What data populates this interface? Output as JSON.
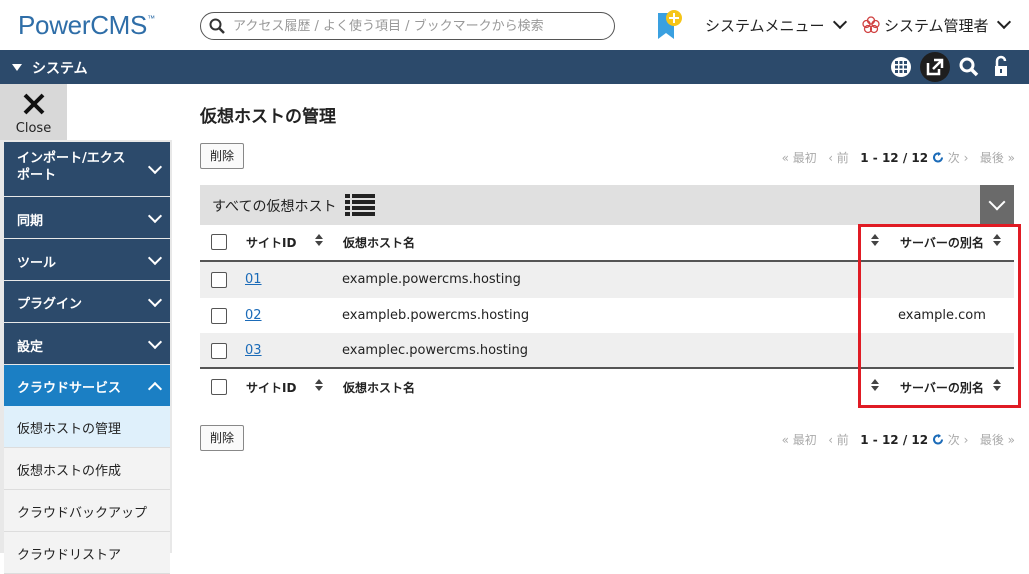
{
  "header": {
    "logo_text": "PowerCMS",
    "logo_tm": "™",
    "search_placeholder": "アクセス履歴 / よく使う項目 / ブックマークから検索",
    "system_menu_label": "システムメニュー",
    "user_menu_label": "システム管理者"
  },
  "system_bar": {
    "title": "システム"
  },
  "sidebar": {
    "close_label": "Close",
    "items": [
      {
        "label": "インポート/エクス\nポート"
      },
      {
        "label": "同期"
      },
      {
        "label": "ツール"
      },
      {
        "label": "プラグイン"
      },
      {
        "label": "設定"
      },
      {
        "label": "クラウドサービス"
      }
    ],
    "sub_items": [
      {
        "label": "仮想ホストの管理"
      },
      {
        "label": "仮想ホストの作成"
      },
      {
        "label": "クラウドバックアップ"
      },
      {
        "label": "クラウドリストア"
      }
    ]
  },
  "main": {
    "page_title": "仮想ホストの管理",
    "delete_label": "削除",
    "pager": {
      "first": "« 最初",
      "prev": "‹ 前",
      "range": "1 - 12 / 12",
      "next": "次 ›",
      "last": "最後 »"
    },
    "filter_label": "すべての仮想ホスト",
    "columns": {
      "site_id": "サイトID",
      "host_name": "仮想ホスト名",
      "alias": "サーバーの別名"
    },
    "rows": [
      {
        "site_id": "01",
        "host_name": "example.powercms.hosting",
        "alias": ""
      },
      {
        "site_id": "02",
        "host_name": "exampleb.powercms.hosting",
        "alias": "example.com"
      },
      {
        "site_id": "03",
        "host_name": "examplec.powercms.hosting",
        "alias": ""
      }
    ]
  },
  "colors": {
    "nav_bg": "#2c4a6b",
    "nav_active": "#1b7fc4",
    "highlight": "#e01b24",
    "logo": "#2f6ea8"
  }
}
